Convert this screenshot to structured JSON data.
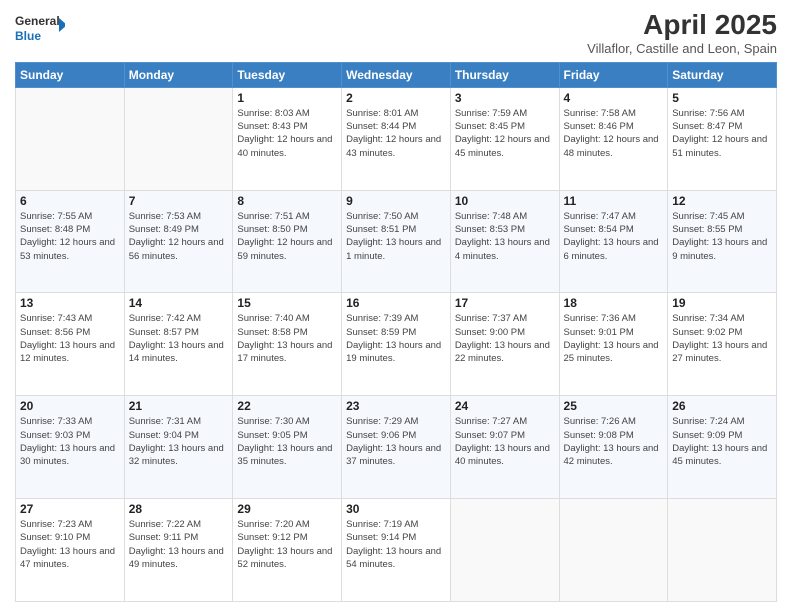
{
  "logo": {
    "line1": "General",
    "line2": "Blue"
  },
  "title": "April 2025",
  "subtitle": "Villaflor, Castille and Leon, Spain",
  "days_header": [
    "Sunday",
    "Monday",
    "Tuesday",
    "Wednesday",
    "Thursday",
    "Friday",
    "Saturday"
  ],
  "weeks": [
    [
      {
        "day": "",
        "info": ""
      },
      {
        "day": "",
        "info": ""
      },
      {
        "day": "1",
        "info": "Sunrise: 8:03 AM\nSunset: 8:43 PM\nDaylight: 12 hours and 40 minutes."
      },
      {
        "day": "2",
        "info": "Sunrise: 8:01 AM\nSunset: 8:44 PM\nDaylight: 12 hours and 43 minutes."
      },
      {
        "day": "3",
        "info": "Sunrise: 7:59 AM\nSunset: 8:45 PM\nDaylight: 12 hours and 45 minutes."
      },
      {
        "day": "4",
        "info": "Sunrise: 7:58 AM\nSunset: 8:46 PM\nDaylight: 12 hours and 48 minutes."
      },
      {
        "day": "5",
        "info": "Sunrise: 7:56 AM\nSunset: 8:47 PM\nDaylight: 12 hours and 51 minutes."
      }
    ],
    [
      {
        "day": "6",
        "info": "Sunrise: 7:55 AM\nSunset: 8:48 PM\nDaylight: 12 hours and 53 minutes."
      },
      {
        "day": "7",
        "info": "Sunrise: 7:53 AM\nSunset: 8:49 PM\nDaylight: 12 hours and 56 minutes."
      },
      {
        "day": "8",
        "info": "Sunrise: 7:51 AM\nSunset: 8:50 PM\nDaylight: 12 hours and 59 minutes."
      },
      {
        "day": "9",
        "info": "Sunrise: 7:50 AM\nSunset: 8:51 PM\nDaylight: 13 hours and 1 minute."
      },
      {
        "day": "10",
        "info": "Sunrise: 7:48 AM\nSunset: 8:53 PM\nDaylight: 13 hours and 4 minutes."
      },
      {
        "day": "11",
        "info": "Sunrise: 7:47 AM\nSunset: 8:54 PM\nDaylight: 13 hours and 6 minutes."
      },
      {
        "day": "12",
        "info": "Sunrise: 7:45 AM\nSunset: 8:55 PM\nDaylight: 13 hours and 9 minutes."
      }
    ],
    [
      {
        "day": "13",
        "info": "Sunrise: 7:43 AM\nSunset: 8:56 PM\nDaylight: 13 hours and 12 minutes."
      },
      {
        "day": "14",
        "info": "Sunrise: 7:42 AM\nSunset: 8:57 PM\nDaylight: 13 hours and 14 minutes."
      },
      {
        "day": "15",
        "info": "Sunrise: 7:40 AM\nSunset: 8:58 PM\nDaylight: 13 hours and 17 minutes."
      },
      {
        "day": "16",
        "info": "Sunrise: 7:39 AM\nSunset: 8:59 PM\nDaylight: 13 hours and 19 minutes."
      },
      {
        "day": "17",
        "info": "Sunrise: 7:37 AM\nSunset: 9:00 PM\nDaylight: 13 hours and 22 minutes."
      },
      {
        "day": "18",
        "info": "Sunrise: 7:36 AM\nSunset: 9:01 PM\nDaylight: 13 hours and 25 minutes."
      },
      {
        "day": "19",
        "info": "Sunrise: 7:34 AM\nSunset: 9:02 PM\nDaylight: 13 hours and 27 minutes."
      }
    ],
    [
      {
        "day": "20",
        "info": "Sunrise: 7:33 AM\nSunset: 9:03 PM\nDaylight: 13 hours and 30 minutes."
      },
      {
        "day": "21",
        "info": "Sunrise: 7:31 AM\nSunset: 9:04 PM\nDaylight: 13 hours and 32 minutes."
      },
      {
        "day": "22",
        "info": "Sunrise: 7:30 AM\nSunset: 9:05 PM\nDaylight: 13 hours and 35 minutes."
      },
      {
        "day": "23",
        "info": "Sunrise: 7:29 AM\nSunset: 9:06 PM\nDaylight: 13 hours and 37 minutes."
      },
      {
        "day": "24",
        "info": "Sunrise: 7:27 AM\nSunset: 9:07 PM\nDaylight: 13 hours and 40 minutes."
      },
      {
        "day": "25",
        "info": "Sunrise: 7:26 AM\nSunset: 9:08 PM\nDaylight: 13 hours and 42 minutes."
      },
      {
        "day": "26",
        "info": "Sunrise: 7:24 AM\nSunset: 9:09 PM\nDaylight: 13 hours and 45 minutes."
      }
    ],
    [
      {
        "day": "27",
        "info": "Sunrise: 7:23 AM\nSunset: 9:10 PM\nDaylight: 13 hours and 47 minutes."
      },
      {
        "day": "28",
        "info": "Sunrise: 7:22 AM\nSunset: 9:11 PM\nDaylight: 13 hours and 49 minutes."
      },
      {
        "day": "29",
        "info": "Sunrise: 7:20 AM\nSunset: 9:12 PM\nDaylight: 13 hours and 52 minutes."
      },
      {
        "day": "30",
        "info": "Sunrise: 7:19 AM\nSunset: 9:14 PM\nDaylight: 13 hours and 54 minutes."
      },
      {
        "day": "",
        "info": ""
      },
      {
        "day": "",
        "info": ""
      },
      {
        "day": "",
        "info": ""
      }
    ]
  ]
}
